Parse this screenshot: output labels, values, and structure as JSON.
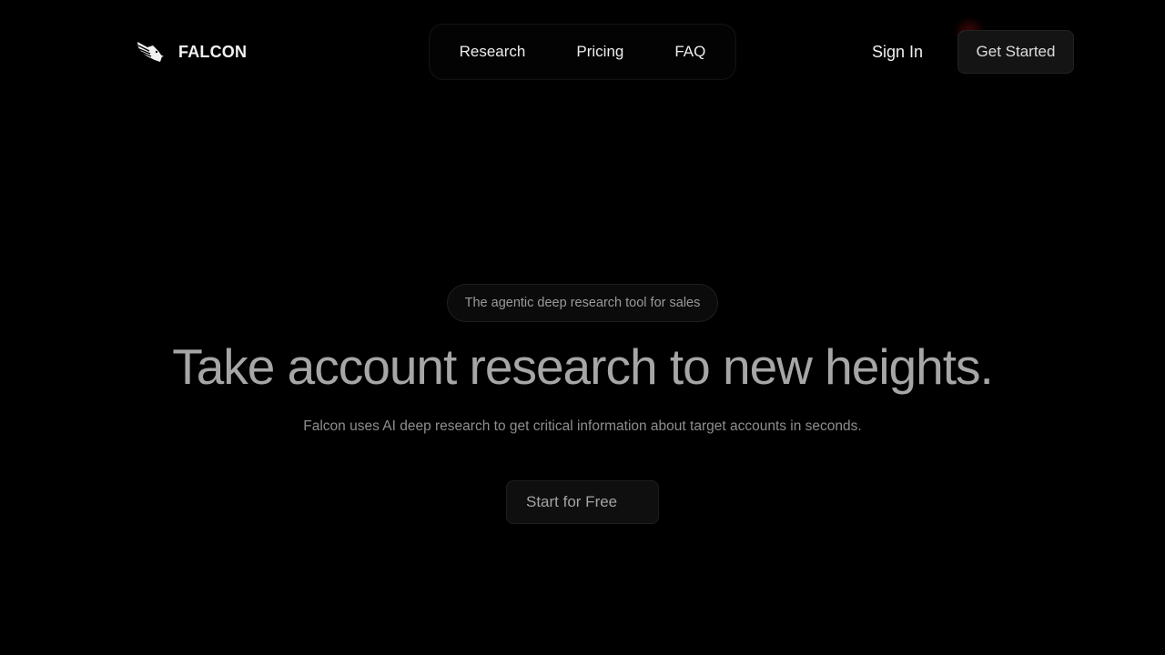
{
  "brand": {
    "name": "FALCON",
    "logo_icon": "falcon-logo-icon"
  },
  "nav": {
    "items": [
      {
        "label": "Research"
      },
      {
        "label": "Pricing"
      },
      {
        "label": "FAQ"
      }
    ]
  },
  "header": {
    "signin_label": "Sign In",
    "get_started_label": "Get Started"
  },
  "hero": {
    "badge": "The agentic deep research tool for sales",
    "title": "Take account research to new heights.",
    "subtitle": "Falcon uses AI deep research to get critical information about target accounts in seconds.",
    "cta_label": "Start for Free"
  },
  "colors": {
    "background": "#000000",
    "accent_glow": "#c81e1e",
    "button_bg": "#141414",
    "title_text": "#a6a6a6"
  }
}
